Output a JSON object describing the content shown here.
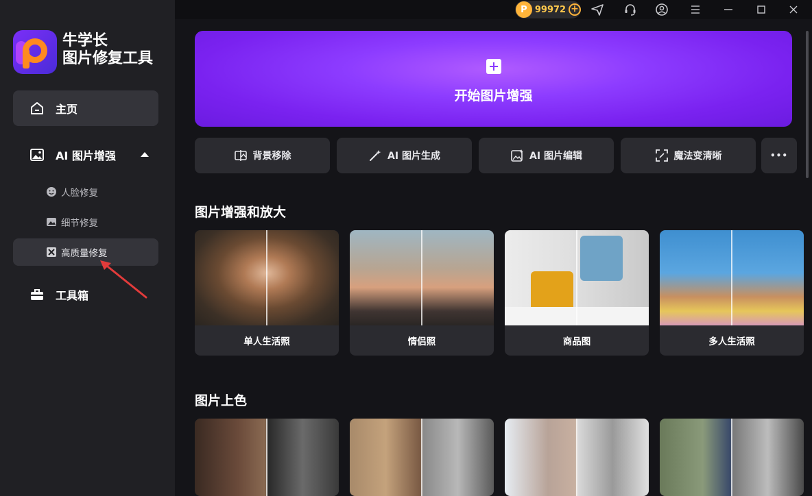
{
  "app": {
    "name_line1": "牛学长",
    "name_line2": "图片修复工具"
  },
  "titlebar": {
    "coin_badge": "P",
    "coins": "99972",
    "coin_plus": "+"
  },
  "sidebar": {
    "home": "主页",
    "ai_enhance": "AI 图片增强",
    "sub_items": [
      "人脸修复",
      "细节修复",
      "高质量修复"
    ],
    "toolbox": "工具箱"
  },
  "hero": {
    "label": "开始图片增强"
  },
  "quick_actions": [
    "背景移除",
    "AI 图片生成",
    "AI 图片编辑",
    "魔法变清晰"
  ],
  "more_label": "•••",
  "sections": [
    {
      "title": "图片增强和放大",
      "cards": [
        "单人生活照",
        "情侣照",
        "商品图",
        "多人生活照"
      ]
    },
    {
      "title": "图片上色",
      "cards": [
        "",
        "",
        "",
        ""
      ]
    }
  ],
  "colors": {
    "accent": "#8a3cff",
    "sidebar_bg": "#202024",
    "main_bg": "#141418",
    "coin": "#ffb43a"
  }
}
